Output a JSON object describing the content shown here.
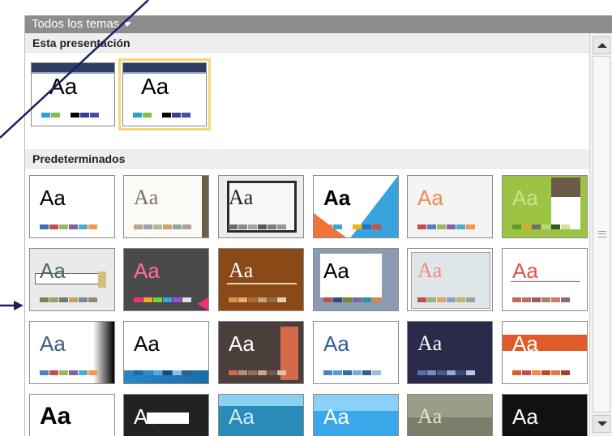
{
  "header": {
    "title": "Todos los temas",
    "caret_icon": "chevron-down-icon"
  },
  "sections": {
    "current": {
      "label": "Esta presentación"
    },
    "defaults": {
      "label": "Predeterminados"
    }
  },
  "tile_text": "Aa",
  "current_themes": [
    {
      "aa": "Aa",
      "selected": false,
      "swatches": [
        "#2c9fd8",
        "#7fc243",
        "#ffffff",
        "#000000",
        "#3c3c90",
        "#4a4ab0"
      ]
    },
    {
      "aa": "Aa",
      "selected": true,
      "swatches": [
        "#2c9fd8",
        "#7fc243",
        "#ffffff",
        "#000000",
        "#3c3c90",
        "#4a4ab0"
      ]
    }
  ],
  "default_themes": [
    [
      {
        "aa": "Aa",
        "bg": "#ffffff",
        "text": "#000000",
        "font": "sans",
        "swatches": [
          "#3f6fb8",
          "#c0504d",
          "#9bbb59",
          "#8064a2",
          "#4bacc6",
          "#f79646"
        ]
      },
      {
        "aa": "Aa",
        "bg": "#fbfaf7",
        "text": "#7a6f5f",
        "font": "serif",
        "swatches": [
          "#b8a98b",
          "#9aa2ab",
          "#b6b69f",
          "#c9a36a",
          "#92a3a3",
          "#b39c91"
        ]
      },
      {
        "aa": "Aa",
        "bg": "#ececec",
        "text": "#222222",
        "font": "serif",
        "swatches": [
          "#6b6b6b",
          "#8a8a8a",
          "#a2a2a2",
          "#575757",
          "#7d7d7d",
          "#969696"
        ]
      },
      {
        "aa": "Aa",
        "bg": "#ffffff",
        "text": "#000000",
        "font": "sans",
        "swatches": [
          "#f0743a",
          "#39a3dc",
          "#ffffff",
          "#f4b400",
          "#2c6fb3",
          "#d84a3a"
        ]
      },
      {
        "aa": "Aa",
        "bg": "#f4f4f4",
        "text": "#f08a4b",
        "font": "sans",
        "swatches": [
          "#c0504d",
          "#4f81bd",
          "#9bbb59",
          "#8064a2",
          "#4bacc6",
          "#f79646"
        ]
      },
      {
        "aa": "Aa",
        "bg": "#9cc442",
        "text": "#c6e48b",
        "font": "sans",
        "swatches": [
          "#5a9a32",
          "#e2a72e",
          "#6e6e6e",
          "#b6d77a",
          "#345c20",
          "#cfe39d"
        ]
      }
    ],
    [
      {
        "aa": "Aa",
        "bg": "#eaeaea",
        "text": "#4a6a5a",
        "font": "sans",
        "swatches": [
          "#8b7d5c",
          "#a0a06b",
          "#6f7f6b",
          "#c2a55e",
          "#7b8b9b",
          "#948a6f"
        ]
      },
      {
        "aa": "Aa",
        "bg": "#4a4a4a",
        "text": "#ff6ca0",
        "font": "sans",
        "swatches": [
          "#f22d7a",
          "#f5a623",
          "#7cd13a",
          "#35a7e0",
          "#9d4de0",
          "#e0e0e0"
        ]
      },
      {
        "aa": "Aa",
        "bg": "#8a4a18",
        "text": "#ffffff",
        "font": "serif",
        "swatches": [
          "#d89448",
          "#e0b070",
          "#b06a30",
          "#c8a57a",
          "#8c6f4c",
          "#e8d2a8"
        ]
      },
      {
        "aa": "Aa",
        "bg": "#8a9bb3",
        "text": "#000000",
        "font": "sans",
        "swatches": [
          "#c0504d",
          "#2d4f80",
          "#6e8a35",
          "#8064a2",
          "#2f8fa3",
          "#d68540"
        ]
      },
      {
        "aa": "Aa",
        "bg": "#ffffff",
        "text": "#f08a7a",
        "font": "serif",
        "swatches": [
          "#c0504d",
          "#94b67a",
          "#e8a15a",
          "#8aa2c2",
          "#c2b46a",
          "#a0a0a0"
        ]
      },
      {
        "aa": "Aa",
        "bg": "#ffffff",
        "text": "#e0554a",
        "font": "sans",
        "swatches": [
          "#c9665b",
          "#b9706a",
          "#9b5f5b",
          "#a88074",
          "#c77f66",
          "#8f6a6a"
        ]
      }
    ],
    [
      {
        "aa": "Aa",
        "bg": "#ffffff",
        "text": "#3f5f7f",
        "font": "sans",
        "swatches": [
          "#4f81bd",
          "#c0504d",
          "#9bbb59",
          "#8064a2",
          "#4bacc6",
          "#f79646"
        ]
      },
      {
        "aa": "Aa",
        "bg": "#ffffff",
        "text": "#000000",
        "font": "sans",
        "swatches": [
          "#1c6aa8",
          "#2a88c8",
          "#5aa7d8",
          "#1a4c7a",
          "#86c2e6",
          "#335f8a"
        ]
      },
      {
        "aa": "Aa",
        "bg": "#4a3f3a",
        "text": "#ffffff",
        "font": "sans",
        "swatches": [
          "#d46a4a",
          "#b0927a",
          "#8b6f58",
          "#c9a985",
          "#6e5a4a",
          "#e0c0a0"
        ]
      },
      {
        "aa": "Aa",
        "bg": "#ffffff",
        "text": "#2f5fa0",
        "font": "sans",
        "swatches": [
          "#4f81bd",
          "#5b9bd5",
          "#2e6aa8",
          "#7fa6d6",
          "#355f8e",
          "#9bbbe0"
        ]
      },
      {
        "aa": "Aa",
        "bg": "#2a2a4a",
        "text": "#ffffff",
        "font": "serif",
        "swatches": [
          "#5a6aa8",
          "#7a8ac8",
          "#4a5a88",
          "#9aa8d8",
          "#3a4a78",
          "#b8c4e8"
        ]
      },
      {
        "aa": "Aa",
        "bg": "#ffffff",
        "text": "#ffffff",
        "font": "sans",
        "swatches": [
          "#e05a2a",
          "#c0504d",
          "#f08a4b",
          "#b84a2a",
          "#d87a4a",
          "#a8402a"
        ]
      }
    ],
    [
      {
        "aa": "Aa",
        "bg": "#ffffff",
        "text": "#000000",
        "font": "sans",
        "swatches": [
          "#4f81bd",
          "#c0504d",
          "#9bbb59",
          "#8064a2",
          "#4bacc6",
          "#f79646"
        ]
      },
      {
        "aa": "Aa",
        "bg": "#222222",
        "text": "#ffffff",
        "font": "sans",
        "swatches": [
          "#6a6a6a",
          "#8a8a8a",
          "#aaaaaa",
          "#5a5a5a",
          "#7a7a7a",
          "#9a9a9a"
        ]
      },
      {
        "aa": "Aa",
        "bg": "#2a8ab8",
        "text": "#c8ecff",
        "font": "sans",
        "swatches": [
          "#1c6aa8",
          "#2ab8d8",
          "#5ad8e8",
          "#1a8aa8",
          "#86e2f0",
          "#2a7aa8"
        ]
      },
      {
        "aa": "Aa",
        "bg": "#3aa8e8",
        "text": "#ffffff",
        "font": "sans",
        "swatches": [
          "#1c6aa8",
          "#4aa8e8",
          "#7ac8f8",
          "#2a88c8",
          "#a8d8f8",
          "#3a78b8"
        ]
      },
      {
        "aa": "Aa",
        "bg": "#7a7e6a",
        "text": "#e8e4c8",
        "font": "serif",
        "swatches": [
          "#a8b87a",
          "#c8c89a",
          "#8a9a6a",
          "#d8d8b8",
          "#6a7a5a",
          "#b8c8a0"
        ]
      },
      {
        "aa": "Aa",
        "bg": "#111111",
        "text": "#ffffff",
        "font": "sans",
        "swatches": [
          "#6a6a6a",
          "#9a9a9a",
          "#cacaca",
          "#4a4a4a",
          "#7a7a7a",
          "#aaaaaa"
        ]
      }
    ]
  ],
  "scrollbar": {
    "up_icon": "scroll-up-arrow-icon",
    "down_icon": "scroll-down-arrow-icon"
  },
  "accent": {
    "selected_border": "#f7d676",
    "header_bg": "#8d8d8d",
    "arrow": "#1b1f5e"
  }
}
